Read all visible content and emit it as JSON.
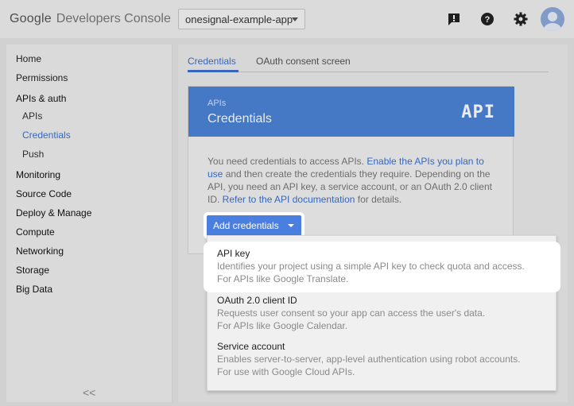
{
  "header": {
    "logo_google": "Google",
    "logo_product": "Developers Console",
    "project_name": "onesignal-example-app",
    "icons": [
      "feedback-icon",
      "help-icon",
      "settings-icon",
      "account-avatar"
    ]
  },
  "sidebar": {
    "items": [
      {
        "label": "Home"
      },
      {
        "label": "Permissions"
      },
      {
        "label": "APIs & auth"
      },
      {
        "label": "APIs"
      },
      {
        "label": "Credentials"
      },
      {
        "label": "Push"
      },
      {
        "label": "Monitoring"
      },
      {
        "label": "Source Code"
      },
      {
        "label": "Deploy & Manage"
      },
      {
        "label": "Compute"
      },
      {
        "label": "Networking"
      },
      {
        "label": "Storage"
      },
      {
        "label": "Big Data"
      }
    ],
    "collapse_label": "<<"
  },
  "tabs": [
    {
      "label": "Credentials"
    },
    {
      "label": "OAuth consent screen"
    }
  ],
  "card": {
    "kicker": "APIs",
    "title": "Credentials",
    "badge": "API",
    "desc_part1": "You need credentials to access APIs. ",
    "desc_link1": "Enable the APIs you plan to use",
    "desc_part2": " and then create the credentials they require. Depending on the API, you need an API key, a service account, or an OAuth 2.0 client ID. ",
    "desc_link2": "Refer to the API documentation",
    "desc_part3": " for details."
  },
  "add_button": {
    "label": "Add credentials"
  },
  "dropdown": {
    "items": [
      {
        "title": "API key",
        "line1": "Identifies your project using a simple API key to check quota and access.",
        "line2": "For APIs like Google Translate."
      },
      {
        "title": "OAuth 2.0 client ID",
        "line1": "Requests user consent so your app can access the user's data.",
        "line2": "For APIs like Google Calendar."
      },
      {
        "title": "Service account",
        "line1": "Enables server-to-server, app-level authentication using robot accounts.",
        "line2": "For use with Google Cloud APIs."
      }
    ]
  },
  "colors": {
    "accent": "#3b6fcf",
    "card_header": "#4d84d6",
    "button": "#4a7fe0"
  }
}
